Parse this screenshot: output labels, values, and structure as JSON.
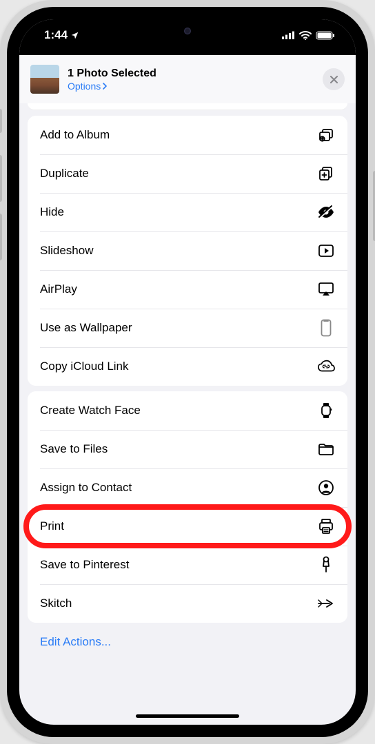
{
  "status": {
    "time": "1:44"
  },
  "sheet": {
    "title": "1 Photo Selected",
    "options_label": "Options"
  },
  "group1": [
    {
      "label": "Add to Album",
      "icon": "album-add-icon"
    },
    {
      "label": "Duplicate",
      "icon": "duplicate-icon"
    },
    {
      "label": "Hide",
      "icon": "hide-icon"
    },
    {
      "label": "Slideshow",
      "icon": "play-rect-icon"
    },
    {
      "label": "AirPlay",
      "icon": "airplay-icon"
    },
    {
      "label": "Use as Wallpaper",
      "icon": "phone-icon"
    },
    {
      "label": "Copy iCloud Link",
      "icon": "cloud-link-icon"
    }
  ],
  "group2": [
    {
      "label": "Create Watch Face",
      "icon": "watch-icon"
    },
    {
      "label": "Save to Files",
      "icon": "folder-icon"
    },
    {
      "label": "Assign to Contact",
      "icon": "contact-icon"
    },
    {
      "label": "Print",
      "icon": "print-icon",
      "highlight": true
    },
    {
      "label": "Save to Pinterest",
      "icon": "pin-icon"
    },
    {
      "label": "Skitch",
      "icon": "skitch-icon"
    }
  ],
  "footer": {
    "edit_label": "Edit Actions..."
  }
}
